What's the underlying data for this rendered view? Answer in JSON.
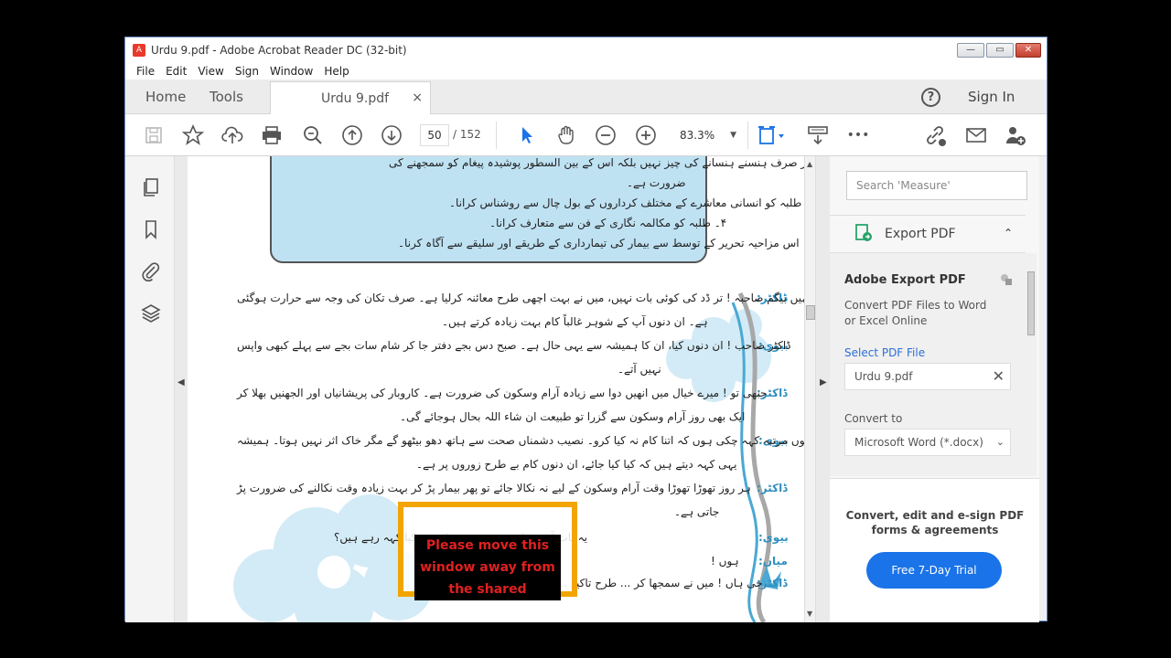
{
  "window": {
    "title": "Urdu 9.pdf - Adobe Acrobat Reader DC (32-bit)",
    "min": "—",
    "max": "▭",
    "close": "✕"
  },
  "menu": [
    "File",
    "Edit",
    "View",
    "Sign",
    "Window",
    "Help"
  ],
  "tabs": {
    "home": "Home",
    "tools": "Tools",
    "doc": "Urdu 9.pdf",
    "doc_close": "×",
    "help": "?",
    "signin": "Sign In"
  },
  "toolbar": {
    "page_current": "50",
    "page_total": "/ 152",
    "zoom": "83.3%",
    "zoom_caret": "▼",
    "more": "•••"
  },
  "right_panel": {
    "search_placeholder": "Search 'Measure'",
    "export_label": "Export PDF",
    "export_up": "⌃",
    "heading": "Adobe Export PDF",
    "desc": "Convert PDF Files to Word or Excel Online",
    "select_label": "Select PDF File",
    "file_name": "Urdu 9.pdf",
    "file_clear": "✕",
    "convert_to": "Convert to",
    "format": "Microsoft Word (*.docx)",
    "format_caret": "⌄",
    "promo": "Convert, edit and e-sign PDF forms & agreements",
    "trial_button": "Free 7-Day Trial"
  },
  "page": {
    "box_lines": [
      "۲۔ طلبہ کو بتانا کہ مزاحیہ تحریر صرف ہنسنے ہنسانے کی چیز نہیں بلکہ اس کے بین السطور پوشیدہ پیغام کو سمجھنے کی",
      "ضرورت ہے۔",
      "۳۔ طلبہ کو انسانی معاشرے کے مختلف کرداروں کے بول چال سے روشناس کرانا۔",
      "۴۔ طلبہ کو مکالمہ نگاری کے فن سے متعارف کرانا۔",
      "۵۔ اس مزاحیہ تحریر کے توسط سے بیمار کی تیمارداری کے طریقے اور سلیقے سے آگاہ کرنا۔"
    ],
    "dialogue": [
      {
        "speaker": "ڈاکٹر:",
        "text": "جی نہیں بیگم صاحبہ ! تر ڈد کی کوئی بات نہیں، میں نے بہت اچھی طرح معائنہ کرلیا ہے۔ صرف تکان کی وجہ سے حرارت ہوگئی"
      },
      {
        "speaker": "",
        "text": "ہے۔ ان دنوں آپ کے شوہر غالباً کام بہت زیادہ کرتے ہیں۔"
      },
      {
        "speaker": "بیوی:",
        "text": "ڈاکٹر صاحب ! ان دنوں کیا، ان کا ہمیشہ سے یہی حال ہے۔ صبح دس بجے دفتر جا کر شام سات بجے سے پہلے کبھی واپس"
      },
      {
        "speaker": "",
        "text": "نہیں آتے۔"
      },
      {
        "speaker": "ڈاکٹر:",
        "text": "جبھی تو ! میرے خیال میں انھیں دوا سے زیادہ آرام وسکون کی ضرورت ہے۔ کاروبار کی پریشانیاں اور الجھنیں بھلا کر"
      },
      {
        "speaker": "",
        "text": "ایک بھی روز آرام وسکون سے گزرا تو طبیعت ان شاء اللہ بحال ہوجائے گی۔"
      },
      {
        "speaker": "بیوی:",
        "text": "بیسیوں مرتبہ کہہ چکی ہوں کہ اتنا کام نہ کیا کرو۔ نصیب دشمناں صحت سے ہاتھ دھو بیٹھو گے مگر خاک اثر نہیں ہوتا۔ ہمیشہ"
      },
      {
        "speaker": "",
        "text": "یہی کہہ دیتے ہیں کہ کیا کیا جائے، ان دنوں کام بے طرح زوروں پر ہے۔"
      },
      {
        "speaker": "ڈاکٹر:",
        "text": "ہر روز تھوڑا تھوڑا وقت آرام وسکون کے لیے نہ نکالا جائے تو پھر بیمار پڑ کر بہت زیادہ وقت نکالنے کی ضرورت پڑ"
      },
      {
        "speaker": "",
        "text": "جاتی ہے۔"
      },
      {
        "speaker": "بیوی:",
        "text": "یہ بات آپ نے انھیں بھی سمجھائی ... کیا کہہ رہے ہیں؟"
      },
      {
        "speaker": "میاں:",
        "text": "ہوں !"
      },
      {
        "speaker": "ڈاکٹر:",
        "text": "جی ہاں ! میں نے سمجھا کر ... طرح تاکید ... موش لیٹنے۔"
      },
      {
        "speaker": "",
        "text": ""
      }
    ]
  },
  "overlay": {
    "message": "Please move this window away from the shared"
  },
  "colors": {
    "accent": "#1a73e8",
    "tab_bg": "#ececec",
    "box_fill": "#bfe2f3",
    "overlay_border": "#f2a500"
  }
}
